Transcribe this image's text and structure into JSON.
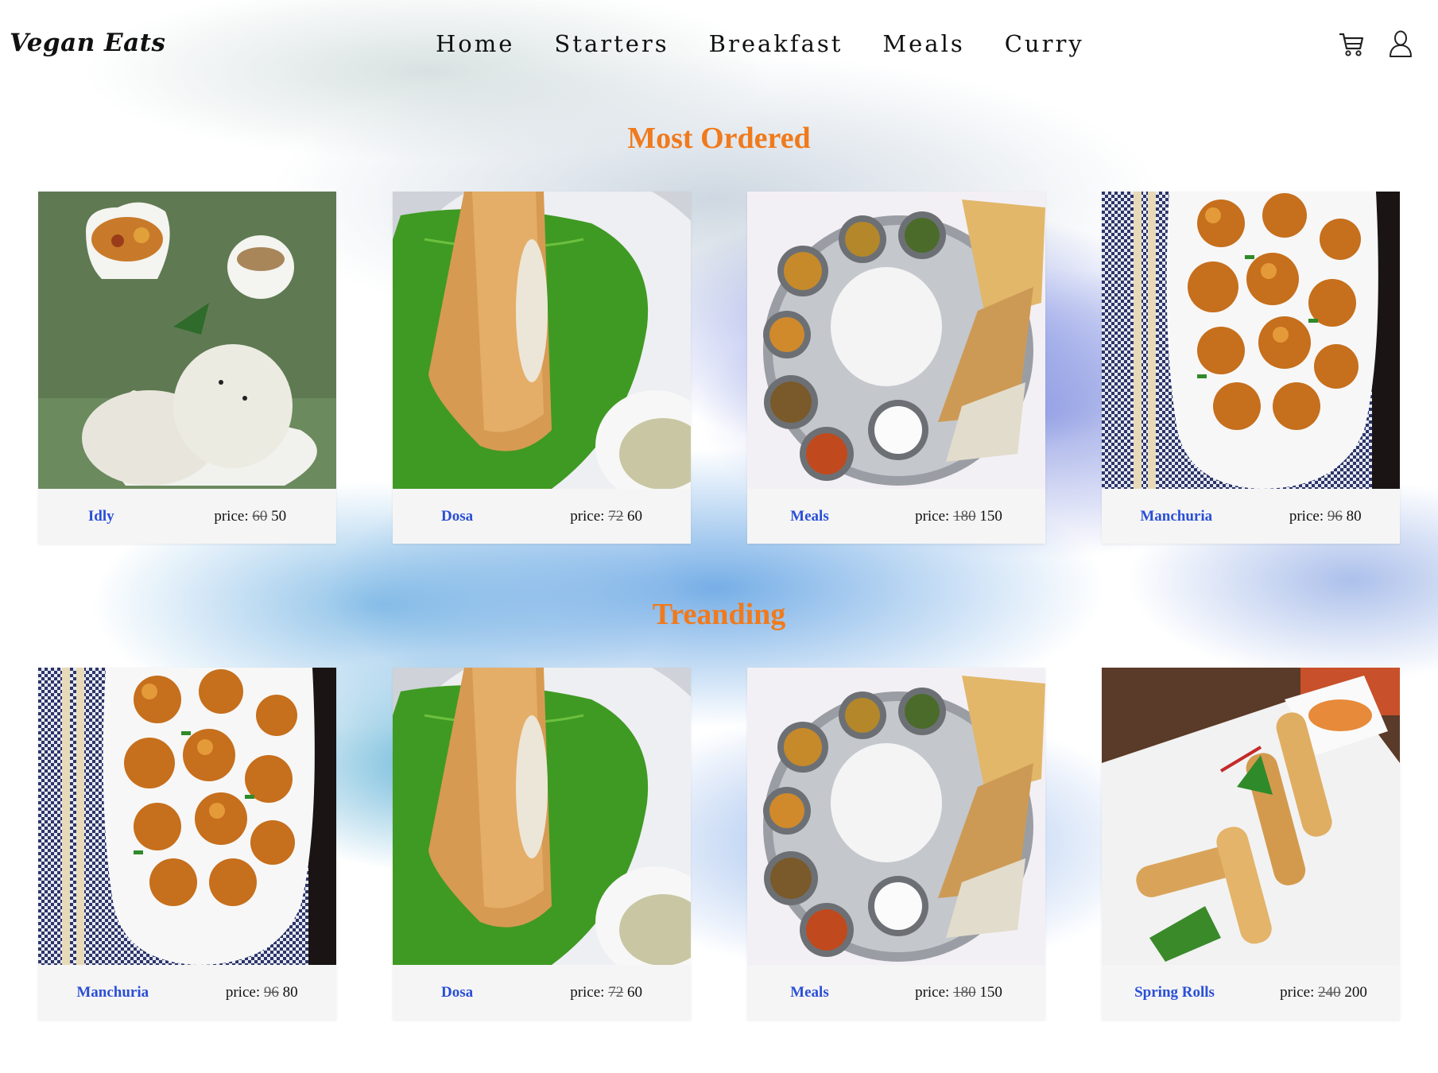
{
  "header": {
    "logo": "Vegan Eats",
    "nav": [
      "Home",
      "Starters",
      "Breakfast",
      "Meals",
      "Curry"
    ],
    "icons": [
      "cart-icon",
      "user-icon"
    ]
  },
  "sections": [
    {
      "title": "Most Ordered",
      "items": [
        {
          "name": "Idly",
          "price_label": "price:",
          "old_price": "60",
          "price": "50",
          "image": "idly"
        },
        {
          "name": "Dosa",
          "price_label": "price:",
          "old_price": "72",
          "price": "60",
          "image": "dosa"
        },
        {
          "name": "Meals",
          "price_label": "price:",
          "old_price": "180",
          "price": "150",
          "image": "meals"
        },
        {
          "name": "Manchuria",
          "price_label": "price:",
          "old_price": "96",
          "price": "80",
          "image": "manchuria"
        }
      ]
    },
    {
      "title": "Treanding",
      "items": [
        {
          "name": "Manchuria",
          "price_label": "price:",
          "old_price": "96",
          "price": "80",
          "image": "manchuria"
        },
        {
          "name": "Dosa",
          "price_label": "price:",
          "old_price": "72",
          "price": "60",
          "image": "dosa"
        },
        {
          "name": "Meals",
          "price_label": "price:",
          "old_price": "180",
          "price": "150",
          "image": "meals"
        },
        {
          "name": "Spring Rolls",
          "price_label": "price:",
          "old_price": "240",
          "price": "200",
          "image": "spring-rolls"
        }
      ]
    }
  ],
  "colors": {
    "accent": "#f07a1c",
    "item_name": "#2a4fd6",
    "card_bg": "#f5f5f5"
  }
}
